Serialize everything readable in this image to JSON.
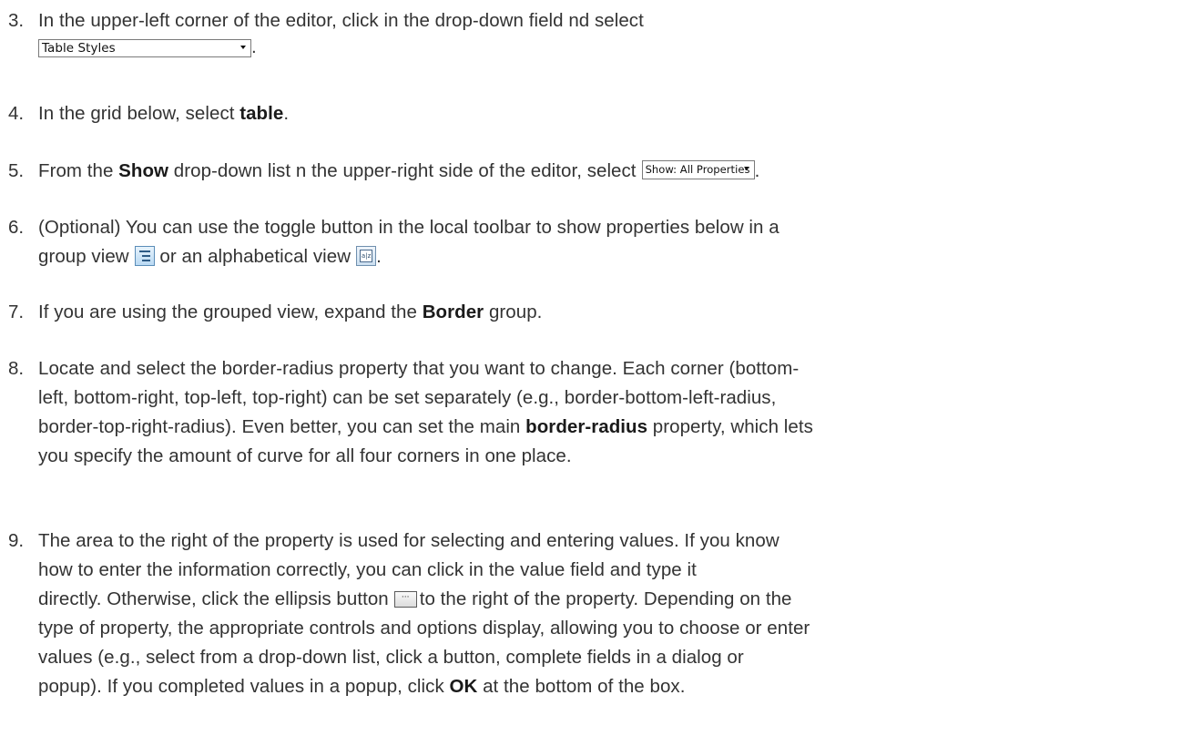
{
  "steps": [
    {
      "number": "3.",
      "line1": "In the upper-left corner of the editor, click in the drop-down field  nd select",
      "combo_value": "Table Styles",
      "after_combo": "."
    },
    {
      "number": "4.",
      "before": "In the grid below, select ",
      "bold": "table",
      "after": "."
    },
    {
      "number": "5.",
      "before": "From the ",
      "bold": "Show",
      "middle": " drop-down list  n the upper-right side of the editor, select",
      "combo_value": "Show: All Properties",
      "after": "."
    },
    {
      "number": "6.",
      "line1": "(Optional) You can use the toggle button in the local toolbar to show properties below in a",
      "line2_a": "group view",
      "line2_b": " or an alphabetical view",
      "line2_c": ".",
      "group_icon": "group-view-icon",
      "alpha_icon": "alphabetical-view-icon",
      "alpha_glyph": "a|z"
    },
    {
      "number": "7.",
      "before": "If you are using the grouped view, expand the ",
      "bold": "Border",
      "after": " group."
    },
    {
      "number": "8.",
      "line1": "Locate and select the border-radius property that you want to change. Each corner (bottom-",
      "line2": "left, bottom-right, top-left, top-right) can be set separately (e.g., border-bottom-left-radius,",
      "line3_a": "border-top-right-radius). Even better, you can set the main ",
      "line3_bold": "border-radius",
      "line3_b": " property, which lets",
      "line4": "you specify the amount of curve for all four corners in one place."
    },
    {
      "number": "9.",
      "line1": "The area to the right of the property is used for selecting and entering values. If you know",
      "line2": "how to enter the information correctly, you can click in the value field and type it",
      "line3_a": "directly. Otherwise, click the ellipsis button",
      "ellipsis_glyph": "···",
      "line3_b": "to the right of the property. Depending on the",
      "line4": "type of property, the appropriate controls and options display, allowing you to choose or enter",
      "line5": "values (e.g., select from a drop-down list, click a button, complete fields in a dialog or",
      "line6_a": "popup). If you completed values in a popup, click ",
      "line6_bold": "OK",
      "line6_b": " at the bottom of the box."
    }
  ]
}
